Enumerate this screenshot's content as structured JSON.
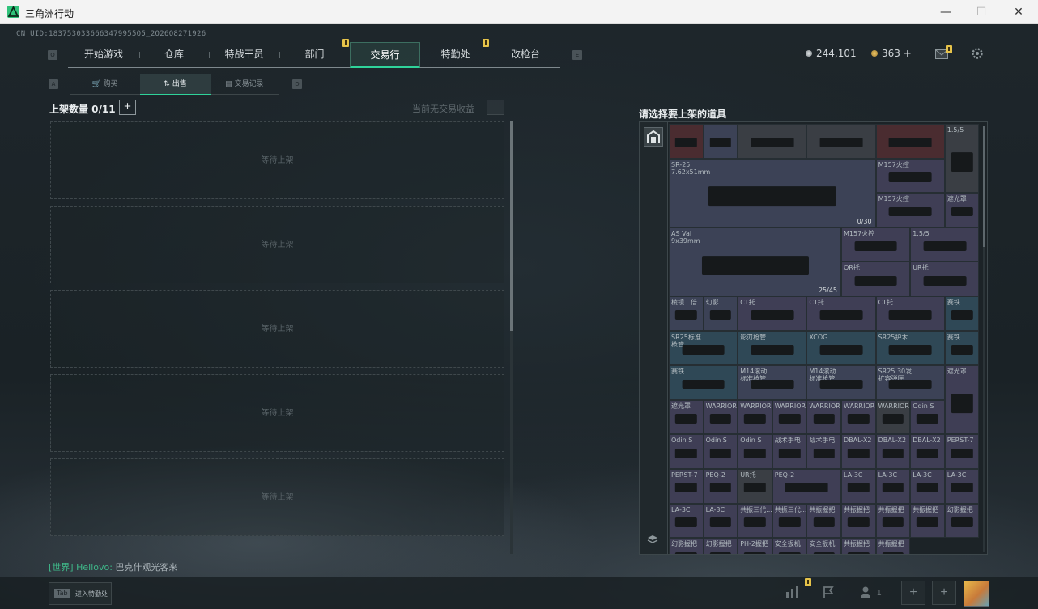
{
  "window": {
    "title": "三角洲行动",
    "minimize": "—",
    "maximize": "☐",
    "close": "✕"
  },
  "uid": "CN UID:1837530336663479955O5_2O26O8271926",
  "nav": {
    "left_key": "Q",
    "right_key": "E",
    "tabs": [
      "开始游戏",
      "仓库",
      "特战干员",
      "部门",
      "交易行",
      "特勤处",
      "改枪台"
    ],
    "active": "交易行"
  },
  "currency": {
    "coins": "244,101",
    "gold": "363 +"
  },
  "subnav": {
    "left_key": "A",
    "right_key": "D",
    "tabs": [
      "购买",
      "出售",
      "交易记录"
    ],
    "active": "出售"
  },
  "listing": {
    "header": "上架数量 0/11",
    "add": "+",
    "earnings": "当前无交易收益",
    "slots": [
      "等待上架",
      "等待上架",
      "等待上架",
      "等待上架",
      "等待上架"
    ]
  },
  "inventory": {
    "title": "请选择要上架的道具",
    "items": [
      {
        "label": "",
        "color": "r"
      },
      {
        "label": "",
        "color": "b"
      },
      {
        "label": "",
        "color": "g"
      },
      {
        "label": "",
        "color": "g"
      },
      {
        "label": "",
        "color": "r"
      },
      {
        "label": "1.5/5",
        "color": "g"
      },
      {
        "label": "SR-25\n7.62x51mm",
        "color": "b",
        "count": "0/30"
      },
      {
        "label": "M157火控",
        "color": "p"
      },
      {
        "label": "M157火控",
        "color": "p"
      },
      {
        "label": "遮光罩",
        "color": "p"
      },
      {
        "label": "AS Val\n9x39mm",
        "color": "b",
        "count": "25/45"
      },
      {
        "label": "M157火控",
        "color": "p"
      },
      {
        "label": "1.5/5",
        "color": "p"
      },
      {
        "label": "QR托",
        "color": "p"
      },
      {
        "label": "UR托",
        "color": "p"
      },
      {
        "label": "棱镜二倍",
        "color": "b"
      },
      {
        "label": "幻影",
        "color": "b"
      },
      {
        "label": "CT托",
        "color": "p"
      },
      {
        "label": "CT托",
        "color": "p"
      },
      {
        "label": "CT托",
        "color": "p"
      },
      {
        "label": "赛铁",
        "color": "t"
      },
      {
        "label": "SR25标准\n枪管",
        "color": "t"
      },
      {
        "label": "影刃枪管",
        "color": "t"
      },
      {
        "label": "XCOG",
        "color": "t"
      },
      {
        "label": "SR25护木",
        "color": "t"
      },
      {
        "label": "赛铁",
        "color": "t"
      },
      {
        "label": "赛铁",
        "color": "t"
      },
      {
        "label": "M14滚动\n标准枪管",
        "color": "b"
      },
      {
        "label": "M14滚动\n标准枪管",
        "color": "b"
      },
      {
        "label": "SR25 30发\n扩容弹匣",
        "color": "b"
      },
      {
        "label": "遮光罩",
        "color": "p"
      },
      {
        "label": "遮光罩",
        "color": "p"
      },
      {
        "label": "WARRIOR...",
        "color": "p"
      },
      {
        "label": "WARRIOR...",
        "color": "p"
      },
      {
        "label": "WARRIOR...",
        "color": "p"
      },
      {
        "label": "WARRIOR...",
        "color": "p"
      },
      {
        "label": "WARRIOR...",
        "color": "p"
      },
      {
        "label": "WARRIOR...",
        "color": "g"
      },
      {
        "label": "Odin S",
        "color": "p"
      },
      {
        "label": "Odin S",
        "color": "p"
      },
      {
        "label": "Odin S",
        "color": "p"
      },
      {
        "label": "Odin S",
        "color": "p"
      },
      {
        "label": "战术手电",
        "color": "p"
      },
      {
        "label": "战术手电",
        "color": "p"
      },
      {
        "label": "DBAL-X2",
        "color": "p"
      },
      {
        "label": "DBAL-X2",
        "color": "p"
      },
      {
        "label": "DBAL-X2",
        "color": "p"
      },
      {
        "label": "PERST-7",
        "color": "p"
      },
      {
        "label": "PERST-7",
        "color": "p"
      },
      {
        "label": "PEQ-2",
        "color": "p"
      },
      {
        "label": "UR托",
        "color": "g"
      },
      {
        "label": "PEQ-2",
        "color": "p"
      },
      {
        "label": "LA-3C",
        "color": "p"
      },
      {
        "label": "LA-3C",
        "color": "p"
      },
      {
        "label": "LA-3C",
        "color": "p"
      },
      {
        "label": "LA-3C",
        "color": "p"
      },
      {
        "label": "LA-3C",
        "color": "p"
      },
      {
        "label": "LA-3C",
        "color": "p"
      },
      {
        "label": "共振三代...",
        "color": "p"
      },
      {
        "label": "共振三代...",
        "color": "p"
      },
      {
        "label": "共振握把",
        "color": "p"
      },
      {
        "label": "共振握把",
        "color": "p"
      },
      {
        "label": "共振握把",
        "color": "p"
      },
      {
        "label": "共振握把",
        "color": "p"
      },
      {
        "label": "幻影握把",
        "color": "p"
      },
      {
        "label": "幻影握把",
        "color": "p"
      },
      {
        "label": "幻影握把",
        "color": "p"
      },
      {
        "label": "PH-2握把",
        "color": "p"
      },
      {
        "label": "安全扳机",
        "color": "p"
      },
      {
        "label": "安全扳机",
        "color": "p"
      },
      {
        "label": "共振握把",
        "color": "p"
      },
      {
        "label": "共振握把",
        "color": "p"
      }
    ]
  },
  "chat": {
    "channel": "[世界]",
    "user": "Hellovo:",
    "message": "巴克什观光客来"
  },
  "bottom": {
    "tab_key": "Tab",
    "tab_label": "进入特勤处",
    "squad_count": "1",
    "plus1": "+",
    "plus2": "+"
  },
  "colors": {
    "accent": "#2fd39a",
    "notification": "#e6c34a"
  }
}
